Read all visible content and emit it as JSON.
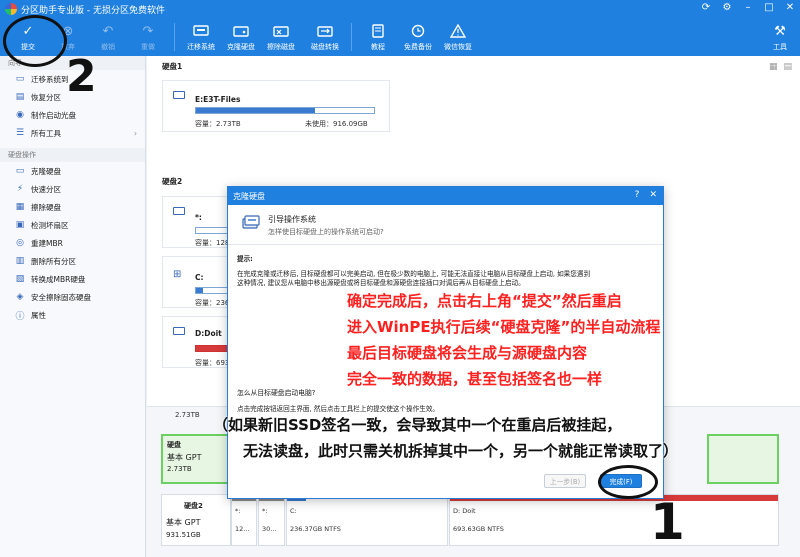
{
  "window": {
    "title": "分区助手专业版 - 无损分区免费软件"
  },
  "toolbar": {
    "items": [
      {
        "label": "提交"
      },
      {
        "label": "放弃"
      },
      {
        "label": "撤销"
      },
      {
        "label": "重做"
      },
      {
        "label": "迁移系统"
      },
      {
        "label": "克隆硬盘"
      },
      {
        "label": "擦除磁盘"
      },
      {
        "label": "磁盘转换"
      },
      {
        "label": "教程"
      },
      {
        "label": "免费备份"
      },
      {
        "label": "微信恢复"
      },
      {
        "label": "工具"
      }
    ]
  },
  "sidebar": {
    "section1_head": "向导",
    "section1": [
      {
        "label": "迁移系统到"
      },
      {
        "label": "恢复分区"
      },
      {
        "label": "制作启动光盘"
      },
      {
        "label": "所有工具"
      }
    ],
    "section2_head": "硬盘操作",
    "section2": [
      {
        "label": "克隆硬盘"
      },
      {
        "label": "快速分区"
      },
      {
        "label": "擦除硬盘"
      },
      {
        "label": "检测坏扇区"
      },
      {
        "label": "重建MBR"
      },
      {
        "label": "删除所有分区"
      },
      {
        "label": "转换成MBR硬盘"
      },
      {
        "label": "安全擦除固态硬盘"
      },
      {
        "label": "属性"
      }
    ]
  },
  "disks": {
    "disk1_label": "硬盘1",
    "disk1_part": {
      "name": "E:E3T-Files",
      "capacity": "容量：2.73TB",
      "free": "未使用：916.09GB",
      "used_fraction": 0.67
    },
    "disk2_label": "硬盘2",
    "disk2_parts": [
      {
        "name": "*:",
        "capacity": "容量：128"
      },
      {
        "name": "C:",
        "capacity": "容量：236"
      },
      {
        "name": "D:Doit",
        "capacity": "容量：693"
      }
    ]
  },
  "bottom": {
    "row1_size": "2.73TB",
    "disk_a": {
      "name": "硬盘",
      "type": "基本 GPT",
      "size": "2.73TB"
    },
    "disk_b": {
      "name": "硬盘2",
      "type": "基本 GPT",
      "size": "931.51GB"
    },
    "parts": [
      {
        "name": "*:",
        "size": "12..."
      },
      {
        "name": "*:",
        "size": "30..."
      },
      {
        "name": "C:",
        "size": "236.37GB NTFS"
      },
      {
        "name": "D: Doit",
        "size": "693.63GB NTFS"
      }
    ]
  },
  "dialog": {
    "title": "克隆硬盘",
    "help": "?",
    "close": "✕",
    "head_title": "引导操作系统",
    "head_sub": "怎样使目标硬盘上的操作系统可启动?",
    "hint_label": "提示:",
    "hint_text1": "在完成克隆或迁移后, 目标硬盘都可以完美启动, 但在极少数的电脑上, 可能无法直接让电脑从目标硬盘上启动, 如果您遇到",
    "hint_text2": "这种情况, 建议您从电脑中移出源硬盘或将目标硬盘和源硬盘连接插口对调后再从目标硬盘上启动。",
    "question": "怎么从目标硬盘启动电脑?",
    "question_text": "点击完成按钮返回主界面, 然后点击工具栏上的提交使这个操作生效。",
    "prev_label": "上一步(B)",
    "done_label": "完成(F)"
  },
  "annotations": {
    "red_lines": [
      "确定完成后，点击右上角“提交”然后重启",
      "进入WinPE执行后续“硬盘克隆”的半自动流程",
      "最后目标硬盘将会生成与源硬盘内容",
      "完全一致的数据，甚至包括签名也一样"
    ],
    "black_line1": "（如果新旧SSD签名一致，会导致其中一个在重启后被挂起，",
    "black_line2": "无法读盘，此时只需关机拆掉其中一个，另一个就能正常读取了）",
    "num_top": "2",
    "num_bottom": "1"
  },
  "colors": {
    "accent": "#1f80e0",
    "annotation_red": "#ff2020",
    "bar_blue": "#3a7ad0",
    "bar_red": "#d63a3a"
  }
}
